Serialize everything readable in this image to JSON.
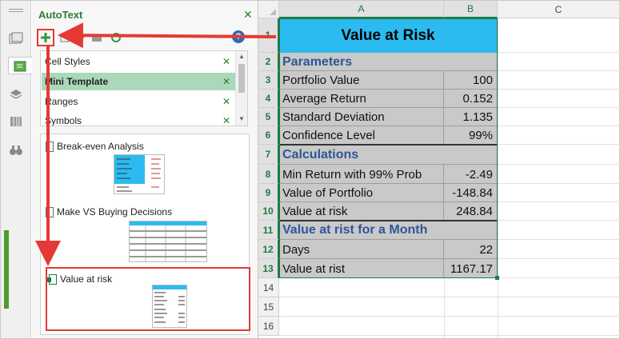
{
  "pane": {
    "title": "AutoText",
    "close_icon": "close-icon",
    "toolbar": {
      "add_icon": "plus-icon",
      "help_label": "?"
    },
    "categories": [
      {
        "label": "Cell Styles",
        "selected": false
      },
      {
        "label": "Mini Template",
        "selected": true
      },
      {
        "label": "Ranges",
        "selected": false
      },
      {
        "label": "Symbols",
        "selected": false
      }
    ],
    "entries": [
      {
        "label": "Break-even Analysis"
      },
      {
        "label": "Make VS Buying Decisions"
      },
      {
        "label": "Value at risk"
      }
    ]
  },
  "sheet": {
    "columns": [
      "A",
      "B",
      "C"
    ],
    "rows": [
      "1",
      "2",
      "3",
      "4",
      "5",
      "6",
      "7",
      "8",
      "9",
      "10",
      "11",
      "12",
      "13",
      "14",
      "15",
      "16"
    ],
    "title": "Value at Risk",
    "cells": [
      {
        "row": 2,
        "a": "Parameters",
        "b": "",
        "section": true
      },
      {
        "row": 3,
        "a": "Portfolio Value",
        "b": "100"
      },
      {
        "row": 4,
        "a": "Average Return",
        "b": "0.152"
      },
      {
        "row": 5,
        "a": "Standard Deviation",
        "b": "1.135"
      },
      {
        "row": 6,
        "a": "Confidence Level",
        "b": "99%"
      },
      {
        "row": 7,
        "a": "Calculations",
        "b": "",
        "section": true
      },
      {
        "row": 8,
        "a": "Min Return with 99% Prob",
        "b": "-2.49"
      },
      {
        "row": 9,
        "a": "Value of Portfolio",
        "b": "-148.84"
      },
      {
        "row": 10,
        "a": "Value at risk",
        "b": "248.84"
      },
      {
        "row": 11,
        "a": "Value at rist for a Month",
        "b": "",
        "section": true
      },
      {
        "row": 12,
        "a": "Days",
        "b": "22"
      },
      {
        "row": 13,
        "a": "Value at rist",
        "b": "1167.17"
      }
    ]
  },
  "colors": {
    "accent_green": "#1e7b45",
    "title_fill": "#2bbbf0",
    "section_text": "#2f5597",
    "highlight": "#e53935"
  }
}
